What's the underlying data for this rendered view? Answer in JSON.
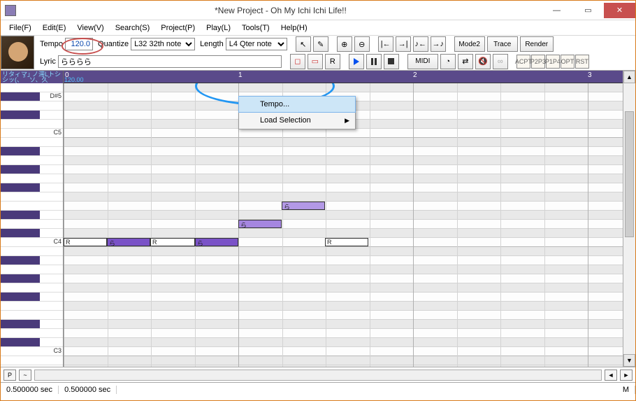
{
  "title": "*New Project - Oh My Ichi Ichi Life!!",
  "menu": [
    "File(F)",
    "Edit(E)",
    "View(V)",
    "Search(S)",
    "Project(P)",
    "Play(L)",
    "Tools(T)",
    "Help(H)"
  ],
  "toolbar": {
    "tempo_label": "Tempo",
    "tempo_value": "120.0",
    "quantize_label": "Quantize",
    "quantize_value": "L32 32th note",
    "length_label": "Length",
    "length_value": "L4  Qter note",
    "lyric_label": "Lyric",
    "lyric_value": "らららら",
    "mode2": "Mode2",
    "trace": "Trace",
    "render": "Render",
    "midi": "MIDI"
  },
  "track": {
    "line1": "リタィマ｣ ノ滞Lトシ",
    "line2": "シッ(、゛ソ、久゛"
  },
  "ruler": {
    "bars": [
      "0",
      "1",
      "2",
      "3"
    ],
    "tempo": "120.00"
  },
  "keys": {
    "dsh5": "D#5",
    "c5": "C5",
    "c4": "C4",
    "c3": "C3"
  },
  "notes": {
    "r": "R",
    "ra": "ら"
  },
  "ctx": {
    "tempo": "Tempo...",
    "load": "Load Selection"
  },
  "status": {
    "t1": "0.500000 sec",
    "t2": "0.500000 sec",
    "m": "M"
  }
}
